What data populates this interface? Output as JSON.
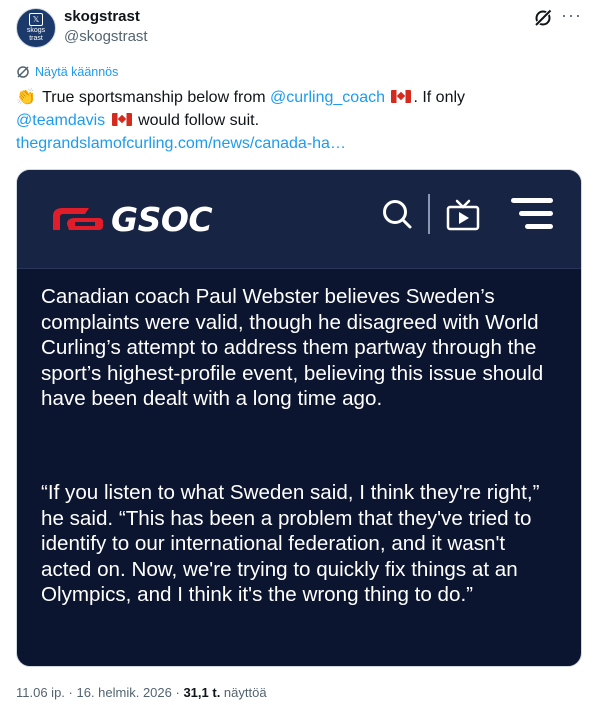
{
  "author": {
    "display_name": "skogstrast",
    "handle": "@skogstrast",
    "avatar_text": [
      "skogs",
      "trast"
    ]
  },
  "translate_label": "Näytä käännös",
  "tweet": {
    "emoji": "👏",
    "part1": " True sportsmanship below from ",
    "mention1": "@curling_coach",
    "part2": ". If only ",
    "mention2": "@teamdavis",
    "part3": " would follow suit.",
    "link": "thegrandslamofcurling.com/news/canada-ha…"
  },
  "media": {
    "logo_text": "GSOC",
    "paragraph1": "Canadian coach Paul Webster believes Sweden’s complaints were valid, though he disagreed with World Curling’s attempt to address them partway through the sport’s highest-profile event, believing this issue should have been dealt with a long time ago.",
    "paragraph2": "“If you listen to what Sweden said, I think they're right,” he said. “This has been a problem that they've tried to identify to our international federation, and it wasn't acted on. Now, we're trying to quickly fix things at an Olympics, and I think it's the wrong thing to do.”"
  },
  "meta": {
    "time": "11.06 ip.",
    "date": "16. helmik. 2026",
    "sep": " · ",
    "views_count": "31,1 t.",
    "views_label": " näyttöä"
  },
  "colors": {
    "link": "#1d9bf0",
    "media_bg": "#0c1530",
    "media_header_bg": "#182444",
    "logo_red": "#e11d2a"
  }
}
